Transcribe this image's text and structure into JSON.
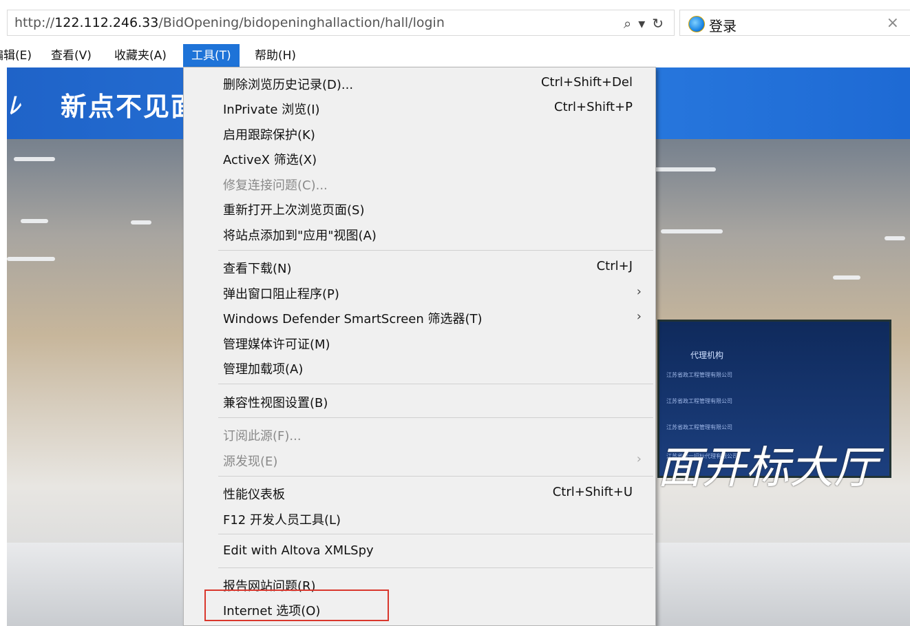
{
  "browser": {
    "url_prefix": "http://",
    "url_host": "122.112.246.33",
    "url_path": "/BidOpening/bidopeninghallaction/hall/login",
    "search_icon": "⌕",
    "dropdown_icon": "▾",
    "refresh_icon": "↻",
    "tab_title": "登录",
    "tab_close": "×"
  },
  "menubar": {
    "edit": "编辑(E)",
    "view": "查看(V)",
    "favorites": "收藏夹(A)",
    "tools": "工具(T)",
    "help": "帮助(H)"
  },
  "page": {
    "logo": "ﾚ",
    "title": "新点不见面开标大厅",
    "hall_text": "面开标大厅",
    "screen_title": "代理机构",
    "screen_lines": [
      "江苏省政工程管理有限公司",
      "江苏省政工程管理有限公司",
      "江苏省政工程管理有限公司",
      "江苏省政一招标代理有限公司"
    ]
  },
  "tools_menu": {
    "items": [
      {
        "label": "删除浏览历史记录(D)...",
        "shortcut": "Ctrl+Shift+Del"
      },
      {
        "label": "InPrivate 浏览(I)",
        "shortcut": "Ctrl+Shift+P"
      },
      {
        "label": "启用跟踪保护(K)"
      },
      {
        "label": "ActiveX 筛选(X)"
      },
      {
        "label": "修复连接问题(C)..."
      },
      {
        "label": "重新打开上次浏览页面(S)"
      },
      {
        "label": "将站点添加到\"应用\"视图(A)"
      },
      {
        "label": "查看下载(N)",
        "shortcut": "Ctrl+J"
      },
      {
        "label": "弹出窗口阻止程序(P)",
        "arrow": "›"
      },
      {
        "label": "Windows Defender SmartScreen 筛选器(T)",
        "arrow": "›"
      },
      {
        "label": "管理媒体许可证(M)"
      },
      {
        "label": "管理加载项(A)"
      },
      {
        "label": "兼容性视图设置(B)"
      },
      {
        "label": "订阅此源(F)..."
      },
      {
        "label": "源发现(E)",
        "arrow": "›"
      },
      {
        "label": "性能仪表板",
        "shortcut": "Ctrl+Shift+U"
      },
      {
        "label": "F12 开发人员工具(L)"
      },
      {
        "label": "Edit with Altova XMLSpy"
      },
      {
        "label": "报告网站问题(R)"
      },
      {
        "label": "Internet 选项(O)"
      }
    ]
  }
}
